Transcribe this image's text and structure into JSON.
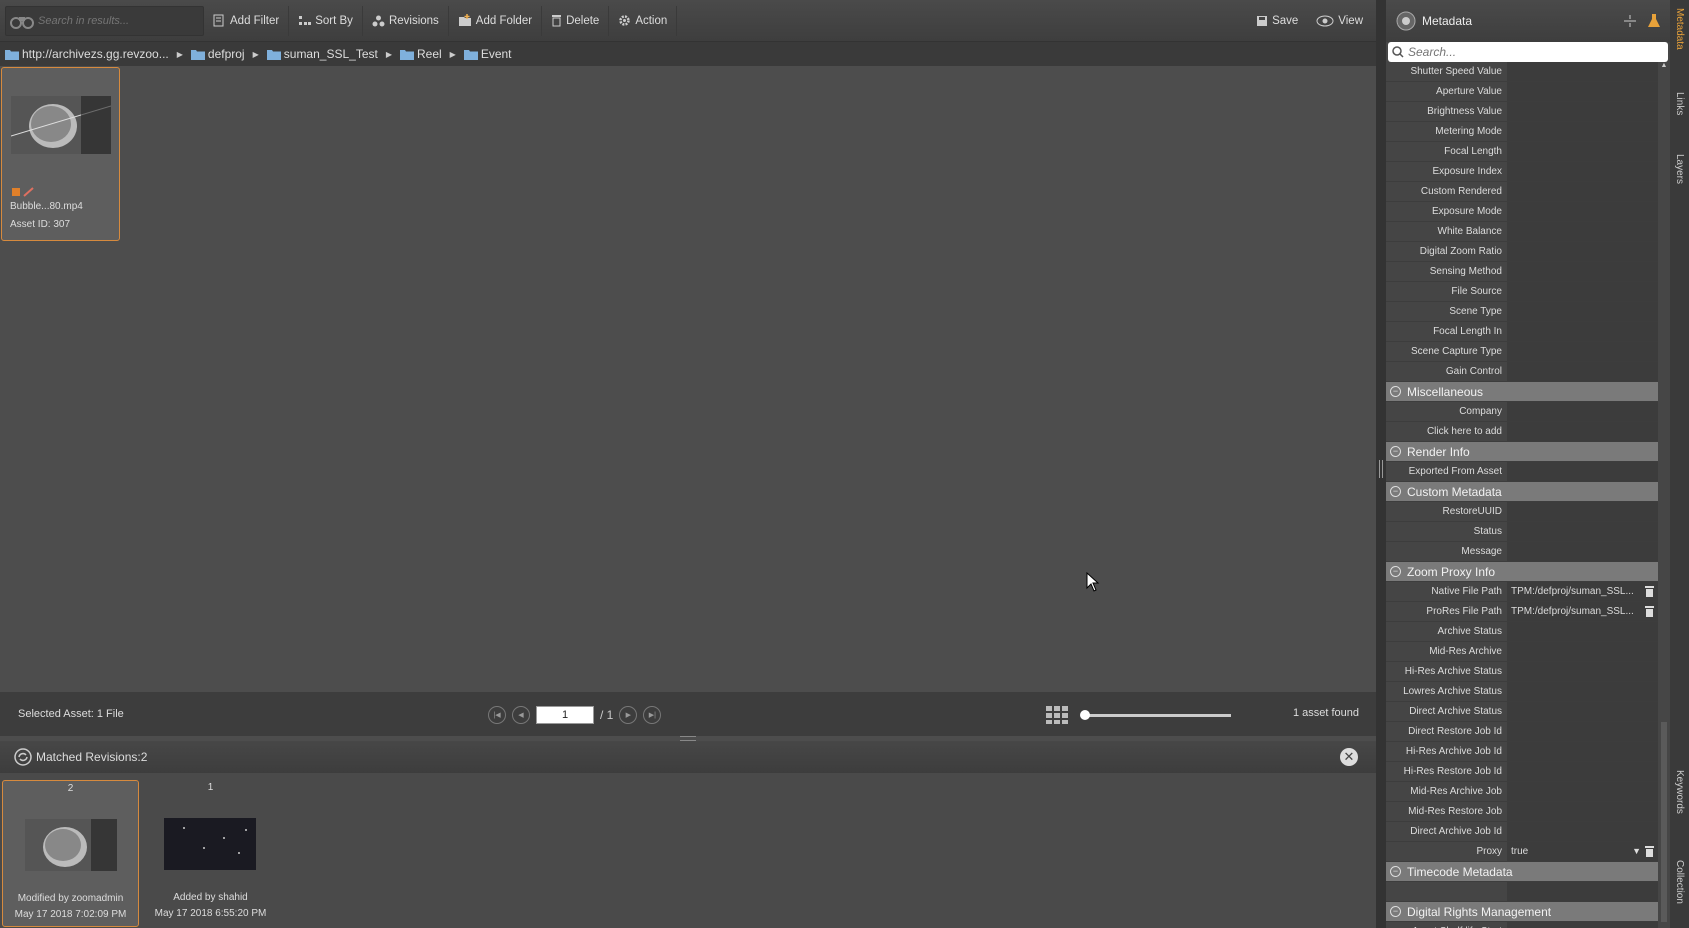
{
  "toolbar": {
    "search_placeholder": "Search in results...",
    "add_filter": "Add Filter",
    "sort_by": "Sort By",
    "revisions": "Revisions",
    "add_folder": "Add Folder",
    "delete": "Delete",
    "action": "Action",
    "save": "Save",
    "view": "View"
  },
  "breadcrumb": [
    "http://archivezs.gg.revzoo...",
    "defproj",
    "suman_SSL_Test",
    "Reel",
    "Event"
  ],
  "asset": {
    "name": "Bubble...80.mp4",
    "id": "Asset ID: 307"
  },
  "status": {
    "selected": "Selected Asset: 1 File",
    "page": "1",
    "total": "/ 1",
    "found": "1 asset found"
  },
  "revisions": {
    "title": "Matched Revisions:2",
    "items": [
      {
        "num": "2",
        "by": "Modified by zoomadmin",
        "date": "May 17 2018 7:02:09 PM"
      },
      {
        "num": "1",
        "by": "Added by shahid",
        "date": "May 17 2018 6:55:20 PM"
      }
    ]
  },
  "metadata": {
    "title": "Metadata",
    "search_placeholder": "Search...",
    "rows": [
      {
        "label": "Shutter Speed Value"
      },
      {
        "label": "Aperture Value"
      },
      {
        "label": "Brightness Value"
      },
      {
        "label": "Metering Mode"
      },
      {
        "label": "Focal Length"
      },
      {
        "label": "Exposure Index"
      },
      {
        "label": "Custom Rendered"
      },
      {
        "label": "Exposure Mode"
      },
      {
        "label": "White Balance"
      },
      {
        "label": "Digital Zoom Ratio"
      },
      {
        "label": "Sensing Method"
      },
      {
        "label": "File Source"
      },
      {
        "label": "Scene Type"
      },
      {
        "label": "Focal Length In"
      },
      {
        "label": "Scene Capture Type"
      },
      {
        "label": "Gain Control"
      },
      {
        "section": "Miscellaneous"
      },
      {
        "label": "Company"
      },
      {
        "label": "Click here to add"
      },
      {
        "section": "Render Info"
      },
      {
        "label": "Exported From Asset"
      },
      {
        "section": "Custom Metadata"
      },
      {
        "label": "RestoreUUID"
      },
      {
        "label": "Status"
      },
      {
        "label": "Message"
      },
      {
        "section": "Zoom Proxy Info"
      },
      {
        "label": "Native File Path",
        "value": "TPM:/defproj/suman_SSL...",
        "trash": true
      },
      {
        "label": "ProRes File Path",
        "value": "TPM:/defproj/suman_SSL...",
        "trash": true
      },
      {
        "label": "Archive Status"
      },
      {
        "label": "Mid-Res Archive"
      },
      {
        "label": "Hi-Res Archive Status"
      },
      {
        "label": "Lowres Archive Status"
      },
      {
        "label": "Direct Archive Status"
      },
      {
        "label": "Direct Restore Job Id"
      },
      {
        "label": "Hi-Res Archive Job Id"
      },
      {
        "label": "Hi-Res Restore Job Id"
      },
      {
        "label": "Mid-Res Archive Job"
      },
      {
        "label": "Mid-Res Restore Job"
      },
      {
        "label": "Direct Archive Job Id"
      },
      {
        "label": "Proxy",
        "value": "true",
        "trash": true,
        "dropdown": true
      },
      {
        "section": "Timecode Metadata"
      },
      {
        "label": ""
      },
      {
        "section": "Digital Rights Management"
      },
      {
        "label": "Asset Shelf life Start"
      }
    ]
  },
  "side_tabs": {
    "metadata": "Metadata",
    "links": "Links",
    "layers": "Layers",
    "keywords": "Keywords",
    "collection": "Collection"
  }
}
